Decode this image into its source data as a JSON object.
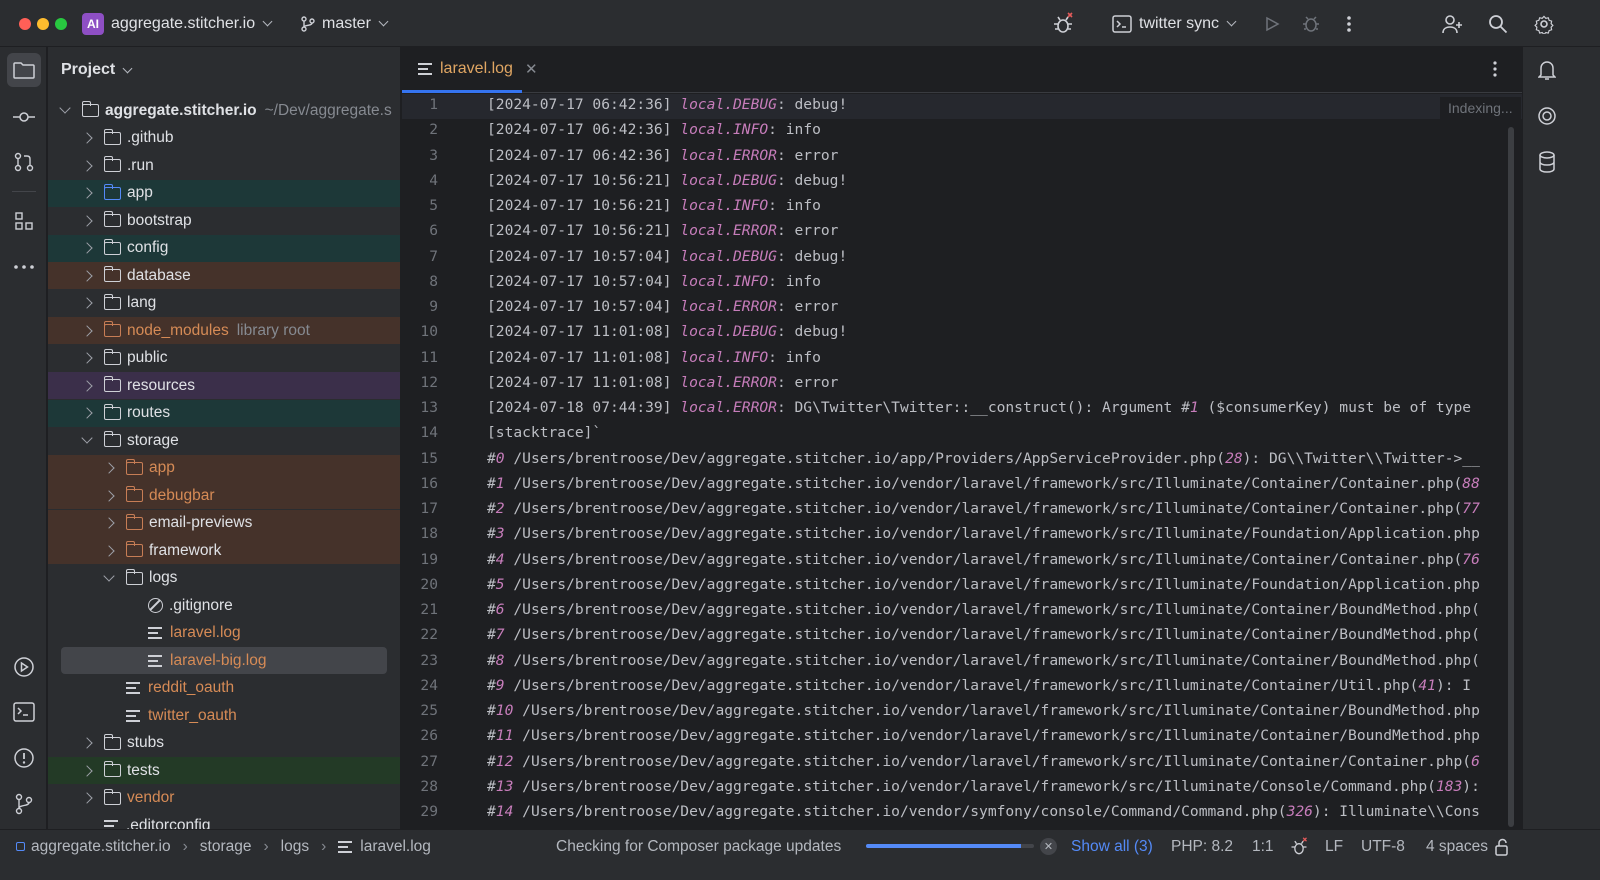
{
  "titlebar": {
    "project_badge": "AI",
    "project_name": "aggregate.stitcher.io",
    "branch": "master",
    "run_config": "twitter sync",
    "colors": {
      "badge": "#8e4fc4",
      "close": "#ff5f57",
      "minimize": "#febc2e",
      "zoom": "#28c840"
    }
  },
  "left_strip_icons": [
    "folder-icon",
    "commit-icon",
    "pull-requests-icon",
    "structure-icon",
    "more-icon",
    "run-icon",
    "terminal-icon",
    "problems-icon",
    "git-icon"
  ],
  "right_strip_icons": [
    "notifications-icon",
    "ai-assistant-icon",
    "database-icon"
  ],
  "project_panel": {
    "title": "Project",
    "tree": [
      {
        "depth": 0,
        "kind": "folder",
        "open": true,
        "label": "aggregate.stitcher.io",
        "hint": "~/Dev/aggregate.s",
        "bold": true,
        "bg": "",
        "color": "#dfe1e5",
        "folder_color": "default"
      },
      {
        "depth": 1,
        "kind": "folder",
        "open": false,
        "label": ".github",
        "bg": "",
        "color": "#dfe1e5",
        "folder_color": "default"
      },
      {
        "depth": 1,
        "kind": "folder",
        "open": false,
        "label": ".run",
        "bg": "",
        "color": "#dfe1e5",
        "folder_color": "default"
      },
      {
        "depth": 1,
        "kind": "folder",
        "open": false,
        "label": "app",
        "bg": "#1d3838",
        "color": "#dfe1e5",
        "folder_color": "blue"
      },
      {
        "depth": 1,
        "kind": "folder",
        "open": false,
        "label": "bootstrap",
        "bg": "",
        "color": "#dfe1e5",
        "folder_color": "default"
      },
      {
        "depth": 1,
        "kind": "folder",
        "open": false,
        "label": "config",
        "bg": "#1d3838",
        "color": "#dfe1e5",
        "folder_color": "default"
      },
      {
        "depth": 1,
        "kind": "folder",
        "open": false,
        "label": "database",
        "bg": "#45322a",
        "color": "#dfe1e5",
        "folder_color": "default"
      },
      {
        "depth": 1,
        "kind": "folder",
        "open": false,
        "label": "lang",
        "bg": "",
        "color": "#dfe1e5",
        "folder_color": "default"
      },
      {
        "depth": 1,
        "kind": "folder",
        "open": false,
        "label": "node_modules",
        "hint": "library root",
        "bg": "#45322a",
        "color": "#d68b56",
        "folder_color": "orange"
      },
      {
        "depth": 1,
        "kind": "folder",
        "open": false,
        "label": "public",
        "bg": "",
        "color": "#dfe1e5",
        "folder_color": "default"
      },
      {
        "depth": 1,
        "kind": "folder",
        "open": false,
        "label": "resources",
        "bg": "#3b2f4a",
        "color": "#dfe1e5",
        "folder_color": "default"
      },
      {
        "depth": 1,
        "kind": "folder",
        "open": false,
        "label": "routes",
        "bg": "#1d3838",
        "color": "#dfe1e5",
        "folder_color": "default"
      },
      {
        "depth": 1,
        "kind": "folder",
        "open": true,
        "label": "storage",
        "bg": "",
        "color": "#dfe1e5",
        "folder_color": "default"
      },
      {
        "depth": 2,
        "kind": "folder",
        "open": false,
        "label": "app",
        "bg": "#45322a",
        "color": "#d68b56",
        "folder_color": "orange"
      },
      {
        "depth": 2,
        "kind": "folder",
        "open": false,
        "label": "debugbar",
        "bg": "#45322a",
        "color": "#d68b56",
        "folder_color": "orange"
      },
      {
        "depth": 2,
        "kind": "folder",
        "open": false,
        "label": "email-previews",
        "bg": "#45322a",
        "color": "#dfe1e5",
        "folder_color": "orange"
      },
      {
        "depth": 2,
        "kind": "folder",
        "open": false,
        "label": "framework",
        "bg": "#45322a",
        "color": "#dfe1e5",
        "folder_color": "orange"
      },
      {
        "depth": 2,
        "kind": "folder",
        "open": true,
        "label": "logs",
        "bg": "",
        "color": "#dfe1e5",
        "folder_color": "default"
      },
      {
        "depth": 3,
        "kind": "ignore",
        "label": ".gitignore",
        "bg": "",
        "color": "#dfe1e5"
      },
      {
        "depth": 3,
        "kind": "file",
        "label": "laravel.log",
        "bg": "",
        "color": "#d68b56"
      },
      {
        "depth": 3,
        "kind": "file",
        "label": "laravel-big.log",
        "bg": "#43454a",
        "color": "#d68b56",
        "selected": true
      },
      {
        "depth": 2,
        "kind": "file",
        "label": "reddit_oauth",
        "bg": "",
        "color": "#d68b56"
      },
      {
        "depth": 2,
        "kind": "file",
        "label": "twitter_oauth",
        "bg": "",
        "color": "#d68b56"
      },
      {
        "depth": 1,
        "kind": "folder",
        "open": false,
        "label": "stubs",
        "bg": "",
        "color": "#dfe1e5",
        "folder_color": "default"
      },
      {
        "depth": 1,
        "kind": "folder",
        "open": false,
        "label": "tests",
        "bg": "#233a26",
        "color": "#dfe1e5",
        "folder_color": "default"
      },
      {
        "depth": 1,
        "kind": "folder",
        "open": false,
        "label": "vendor",
        "bg": "",
        "color": "#d68b56",
        "folder_color": "default"
      },
      {
        "depth": 1,
        "kind": "file",
        "label": ".editorconfig",
        "bg": "",
        "color": "#dfe1e5"
      }
    ]
  },
  "editor": {
    "tab_label": "laravel.log",
    "indexing": "Indexing...",
    "lines": [
      {
        "n": "1",
        "parts": [
          [
            "t",
            "[2024-07-17 06:42:36] "
          ],
          [
            "l",
            "local.DEBUG"
          ],
          [
            "t",
            ": debug!"
          ]
        ]
      },
      {
        "n": "2",
        "parts": [
          [
            "t",
            "[2024-07-17 06:42:36] "
          ],
          [
            "l",
            "local.INFO"
          ],
          [
            "t",
            ": info"
          ]
        ]
      },
      {
        "n": "3",
        "parts": [
          [
            "t",
            "[2024-07-17 06:42:36] "
          ],
          [
            "l",
            "local.ERROR"
          ],
          [
            "t",
            ": error"
          ]
        ]
      },
      {
        "n": "4",
        "parts": [
          [
            "t",
            "[2024-07-17 10:56:21] "
          ],
          [
            "l",
            "local.DEBUG"
          ],
          [
            "t",
            ": debug!"
          ]
        ]
      },
      {
        "n": "5",
        "parts": [
          [
            "t",
            "[2024-07-17 10:56:21] "
          ],
          [
            "l",
            "local.INFO"
          ],
          [
            "t",
            ": info"
          ]
        ]
      },
      {
        "n": "6",
        "parts": [
          [
            "t",
            "[2024-07-17 10:56:21] "
          ],
          [
            "l",
            "local.ERROR"
          ],
          [
            "t",
            ": error"
          ]
        ]
      },
      {
        "n": "7",
        "parts": [
          [
            "t",
            "[2024-07-17 10:57:04] "
          ],
          [
            "l",
            "local.DEBUG"
          ],
          [
            "t",
            ": debug!"
          ]
        ]
      },
      {
        "n": "8",
        "parts": [
          [
            "t",
            "[2024-07-17 10:57:04] "
          ],
          [
            "l",
            "local.INFO"
          ],
          [
            "t",
            ": info"
          ]
        ]
      },
      {
        "n": "9",
        "parts": [
          [
            "t",
            "[2024-07-17 10:57:04] "
          ],
          [
            "l",
            "local.ERROR"
          ],
          [
            "t",
            ": error"
          ]
        ]
      },
      {
        "n": "10",
        "parts": [
          [
            "t",
            "[2024-07-17 11:01:08] "
          ],
          [
            "l",
            "local.DEBUG"
          ],
          [
            "t",
            ": debug!"
          ]
        ]
      },
      {
        "n": "11",
        "parts": [
          [
            "t",
            "[2024-07-17 11:01:08] "
          ],
          [
            "l",
            "local.INFO"
          ],
          [
            "t",
            ": info"
          ]
        ]
      },
      {
        "n": "12",
        "parts": [
          [
            "t",
            "[2024-07-17 11:01:08] "
          ],
          [
            "l",
            "local.ERROR"
          ],
          [
            "t",
            ": error"
          ]
        ]
      },
      {
        "n": "13",
        "parts": [
          [
            "t",
            "[2024-07-18 07:44:39] "
          ],
          [
            "l",
            "local.ERROR"
          ],
          [
            "t",
            ": DG\\Twitter\\Twitter::__construct(): Argument #"
          ],
          [
            "l",
            "1"
          ],
          [
            "t",
            " ($consumerKey) must be of type"
          ]
        ]
      },
      {
        "n": "14",
        "parts": [
          [
            "t",
            "[stacktrace]`"
          ]
        ]
      },
      {
        "n": "15",
        "parts": [
          [
            "t",
            "#"
          ],
          [
            "l",
            "0"
          ],
          [
            "t",
            " /Users/brentroose/Dev/aggregate.stitcher.io/app/Providers/AppServiceProvider.php("
          ],
          [
            "l",
            "28"
          ],
          [
            "t",
            "): DG\\\\Twitter\\\\Twitter->__"
          ]
        ]
      },
      {
        "n": "16",
        "parts": [
          [
            "t",
            "#"
          ],
          [
            "l",
            "1"
          ],
          [
            "t",
            " /Users/brentroose/Dev/aggregate.stitcher.io/vendor/laravel/framework/src/Illuminate/Container/Container.php("
          ],
          [
            "l",
            "88"
          ]
        ]
      },
      {
        "n": "17",
        "parts": [
          [
            "t",
            "#"
          ],
          [
            "l",
            "2"
          ],
          [
            "t",
            " /Users/brentroose/Dev/aggregate.stitcher.io/vendor/laravel/framework/src/Illuminate/Container/Container.php("
          ],
          [
            "l",
            "77"
          ]
        ]
      },
      {
        "n": "18",
        "parts": [
          [
            "t",
            "#"
          ],
          [
            "l",
            "3"
          ],
          [
            "t",
            " /Users/brentroose/Dev/aggregate.stitcher.io/vendor/laravel/framework/src/Illuminate/Foundation/Application.php"
          ]
        ]
      },
      {
        "n": "19",
        "parts": [
          [
            "t",
            "#"
          ],
          [
            "l",
            "4"
          ],
          [
            "t",
            " /Users/brentroose/Dev/aggregate.stitcher.io/vendor/laravel/framework/src/Illuminate/Container/Container.php("
          ],
          [
            "l",
            "76"
          ]
        ]
      },
      {
        "n": "20",
        "parts": [
          [
            "t",
            "#"
          ],
          [
            "l",
            "5"
          ],
          [
            "t",
            " /Users/brentroose/Dev/aggregate.stitcher.io/vendor/laravel/framework/src/Illuminate/Foundation/Application.php"
          ]
        ]
      },
      {
        "n": "21",
        "parts": [
          [
            "t",
            "#"
          ],
          [
            "l",
            "6"
          ],
          [
            "t",
            " /Users/brentroose/Dev/aggregate.stitcher.io/vendor/laravel/framework/src/Illuminate/Container/BoundMethod.php("
          ]
        ]
      },
      {
        "n": "22",
        "parts": [
          [
            "t",
            "#"
          ],
          [
            "l",
            "7"
          ],
          [
            "t",
            " /Users/brentroose/Dev/aggregate.stitcher.io/vendor/laravel/framework/src/Illuminate/Container/BoundMethod.php("
          ]
        ]
      },
      {
        "n": "23",
        "parts": [
          [
            "t",
            "#"
          ],
          [
            "l",
            "8"
          ],
          [
            "t",
            " /Users/brentroose/Dev/aggregate.stitcher.io/vendor/laravel/framework/src/Illuminate/Container/BoundMethod.php("
          ]
        ]
      },
      {
        "n": "24",
        "parts": [
          [
            "t",
            "#"
          ],
          [
            "l",
            "9"
          ],
          [
            "t",
            " /Users/brentroose/Dev/aggregate.stitcher.io/vendor/laravel/framework/src/Illuminate/Container/Util.php("
          ],
          [
            "l",
            "41"
          ],
          [
            "t",
            "): I"
          ]
        ]
      },
      {
        "n": "25",
        "parts": [
          [
            "t",
            "#"
          ],
          [
            "l",
            "10"
          ],
          [
            "t",
            " /Users/brentroose/Dev/aggregate.stitcher.io/vendor/laravel/framework/src/Illuminate/Container/BoundMethod.php"
          ]
        ]
      },
      {
        "n": "26",
        "parts": [
          [
            "t",
            "#"
          ],
          [
            "l",
            "11"
          ],
          [
            "t",
            " /Users/brentroose/Dev/aggregate.stitcher.io/vendor/laravel/framework/src/Illuminate/Container/BoundMethod.php"
          ]
        ]
      },
      {
        "n": "27",
        "parts": [
          [
            "t",
            "#"
          ],
          [
            "l",
            "12"
          ],
          [
            "t",
            " /Users/brentroose/Dev/aggregate.stitcher.io/vendor/laravel/framework/src/Illuminate/Container/Container.php("
          ],
          [
            "l",
            "6"
          ]
        ]
      },
      {
        "n": "28",
        "parts": [
          [
            "t",
            "#"
          ],
          [
            "l",
            "13"
          ],
          [
            "t",
            " /Users/brentroose/Dev/aggregate.stitcher.io/vendor/laravel/framework/src/Illuminate/Console/Command.php("
          ],
          [
            "l",
            "183"
          ],
          [
            "t",
            "):"
          ]
        ]
      },
      {
        "n": "29",
        "parts": [
          [
            "t",
            "#"
          ],
          [
            "l",
            "14"
          ],
          [
            "t",
            " /Users/brentroose/Dev/aggregate.stitcher.io/vendor/symfony/console/Command/Command.php("
          ],
          [
            "l",
            "326"
          ],
          [
            "t",
            "): Illuminate\\\\Cons"
          ]
        ]
      }
    ]
  },
  "statusbar": {
    "breadcrumb": [
      "aggregate.stitcher.io",
      "storage",
      "logs",
      "laravel.log"
    ],
    "task": "Checking for Composer package updates",
    "task_progress": 0.92,
    "show_all": "Show all (3)",
    "php": "PHP: 8.2",
    "position": "1:1",
    "line_sep": "LF",
    "encoding": "UTF-8",
    "indent": "4 spaces"
  }
}
